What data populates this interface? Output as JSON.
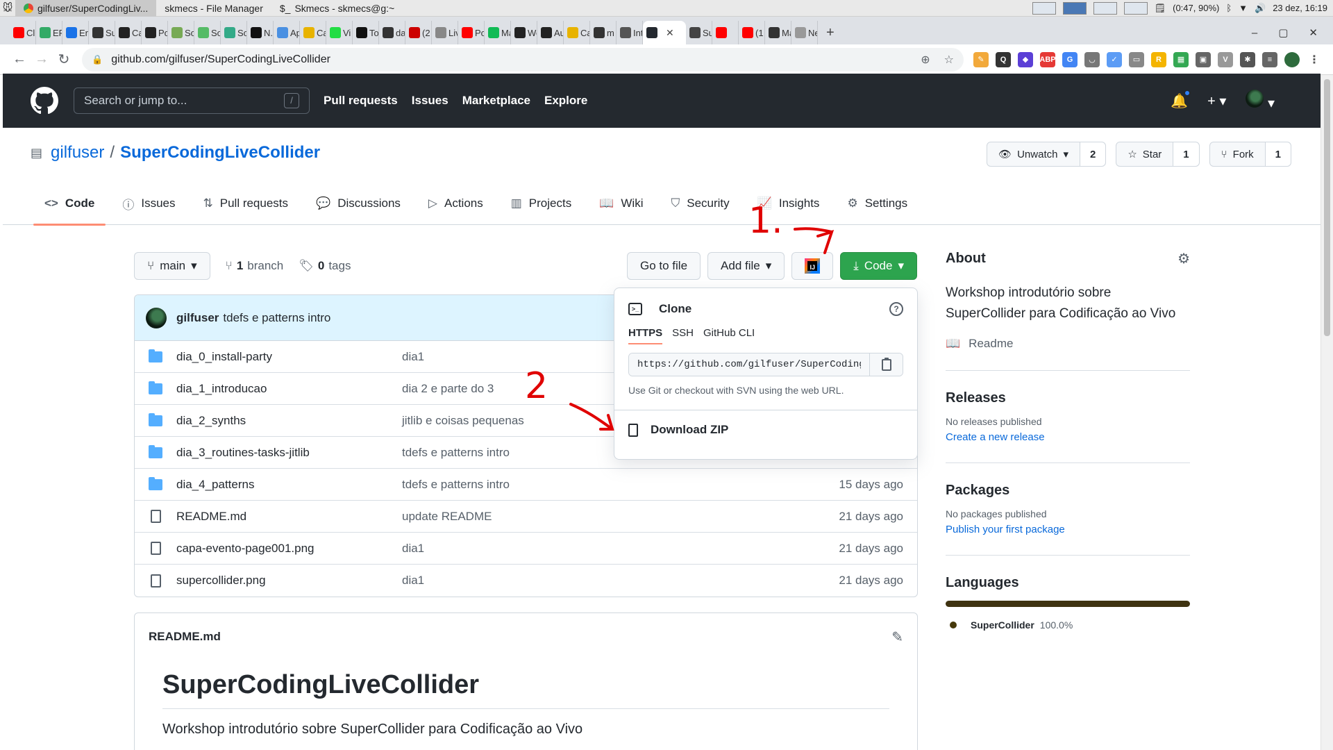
{
  "taskbar": {
    "tasks": [
      {
        "label": "gilfuser/SuperCodingLiv..."
      },
      {
        "label": "skmecs - File Manager"
      },
      {
        "label": "Skmecs - skmecs@g:~"
      }
    ],
    "battery": "(0:47, 90%)",
    "clock": "23 dez, 16:19"
  },
  "browser": {
    "tabs": [
      "Cl",
      "ER",
      "En",
      "Su",
      "Ca",
      "Po",
      "So",
      "So",
      "So",
      "N.",
      "Ap",
      "Ca",
      "Vi",
      "To",
      "da",
      "(2",
      "Liv",
      "Po",
      "Ma",
      "We",
      "Au",
      "Ca",
      "m",
      "Int",
      "",
      "Su",
      "",
      "(1",
      "Ma",
      "New T"
    ],
    "active_tab_index": 24,
    "url": "github.com/gilfuser/SuperCodingLiveCollider"
  },
  "gh_header": {
    "search_placeholder": "Search or jump to...",
    "slash_key": "/",
    "nav": [
      "Pull requests",
      "Issues",
      "Marketplace",
      "Explore"
    ]
  },
  "repo": {
    "owner": "gilfuser",
    "separator": "/",
    "name": "SuperCodingLiveCollider",
    "watch_label": "Unwatch",
    "watch_count": "2",
    "star_label": "Star",
    "star_count": "1",
    "fork_label": "Fork",
    "fork_count": "1",
    "tabs": [
      "Code",
      "Issues",
      "Pull requests",
      "Discussions",
      "Actions",
      "Projects",
      "Wiki",
      "Security",
      "Insights",
      "Settings"
    ]
  },
  "branchbar": {
    "branch": "main",
    "branch_count": "1",
    "branch_word": "branch",
    "tag_count": "0",
    "tag_word": "tags",
    "go_to_file": "Go to file",
    "add_file": "Add file",
    "code": "Code"
  },
  "commit": {
    "author": "gilfuser",
    "message": "tdefs e patterns intro"
  },
  "files": [
    {
      "type": "dir",
      "name": "dia_0_install-party",
      "msg": "dia1",
      "date": ""
    },
    {
      "type": "dir",
      "name": "dia_1_introducao",
      "msg": "dia 2 e parte do 3",
      "date": ""
    },
    {
      "type": "dir",
      "name": "dia_2_synths",
      "msg": "jitlib e coisas pequenas",
      "date": ""
    },
    {
      "type": "dir",
      "name": "dia_3_routines-tasks-jitlib",
      "msg": "tdefs e patterns intro",
      "date": ""
    },
    {
      "type": "dir",
      "name": "dia_4_patterns",
      "msg": "tdefs e patterns intro",
      "date": "15 days ago"
    },
    {
      "type": "file",
      "name": "README.md",
      "msg": "update README",
      "date": "21 days ago"
    },
    {
      "type": "file",
      "name": "capa-evento-page001.png",
      "msg": "dia1",
      "date": "21 days ago"
    },
    {
      "type": "file",
      "name": "supercollider.png",
      "msg": "dia1",
      "date": "21 days ago"
    }
  ],
  "clone": {
    "title": "Clone",
    "tabs": [
      "HTTPS",
      "SSH",
      "GitHub CLI"
    ],
    "url": "https://github.com/gilfuser/SuperCodingLiveCollider.git",
    "hint": "Use Git or checkout with SVN using the web URL.",
    "download_zip": "Download ZIP"
  },
  "readme": {
    "filename": "README.md",
    "heading": "SuperCodingLiveCollider",
    "text": "Workshop introdutório sobre SuperCollider para Codificação ao Vivo"
  },
  "sidebar": {
    "about_title": "About",
    "about_desc": "Workshop introdutório sobre SuperCollider para Codificação ao Vivo",
    "readme_label": "Readme",
    "releases_title": "Releases",
    "releases_none": "No releases published",
    "releases_link": "Create a new release",
    "packages_title": "Packages",
    "packages_none": "No packages published",
    "packages_link": "Publish your first package",
    "languages_title": "Languages",
    "language_name": "SuperCollider",
    "language_pct": "100.0%"
  },
  "annotations": {
    "step1": "1.",
    "step2": "2",
    "color": "#e00000"
  },
  "colors": {
    "gh_header": "#24292f",
    "code_button": "#2da44e",
    "link": "#0969da",
    "tab_underline": "#fd8c73",
    "language": "#46390b"
  }
}
